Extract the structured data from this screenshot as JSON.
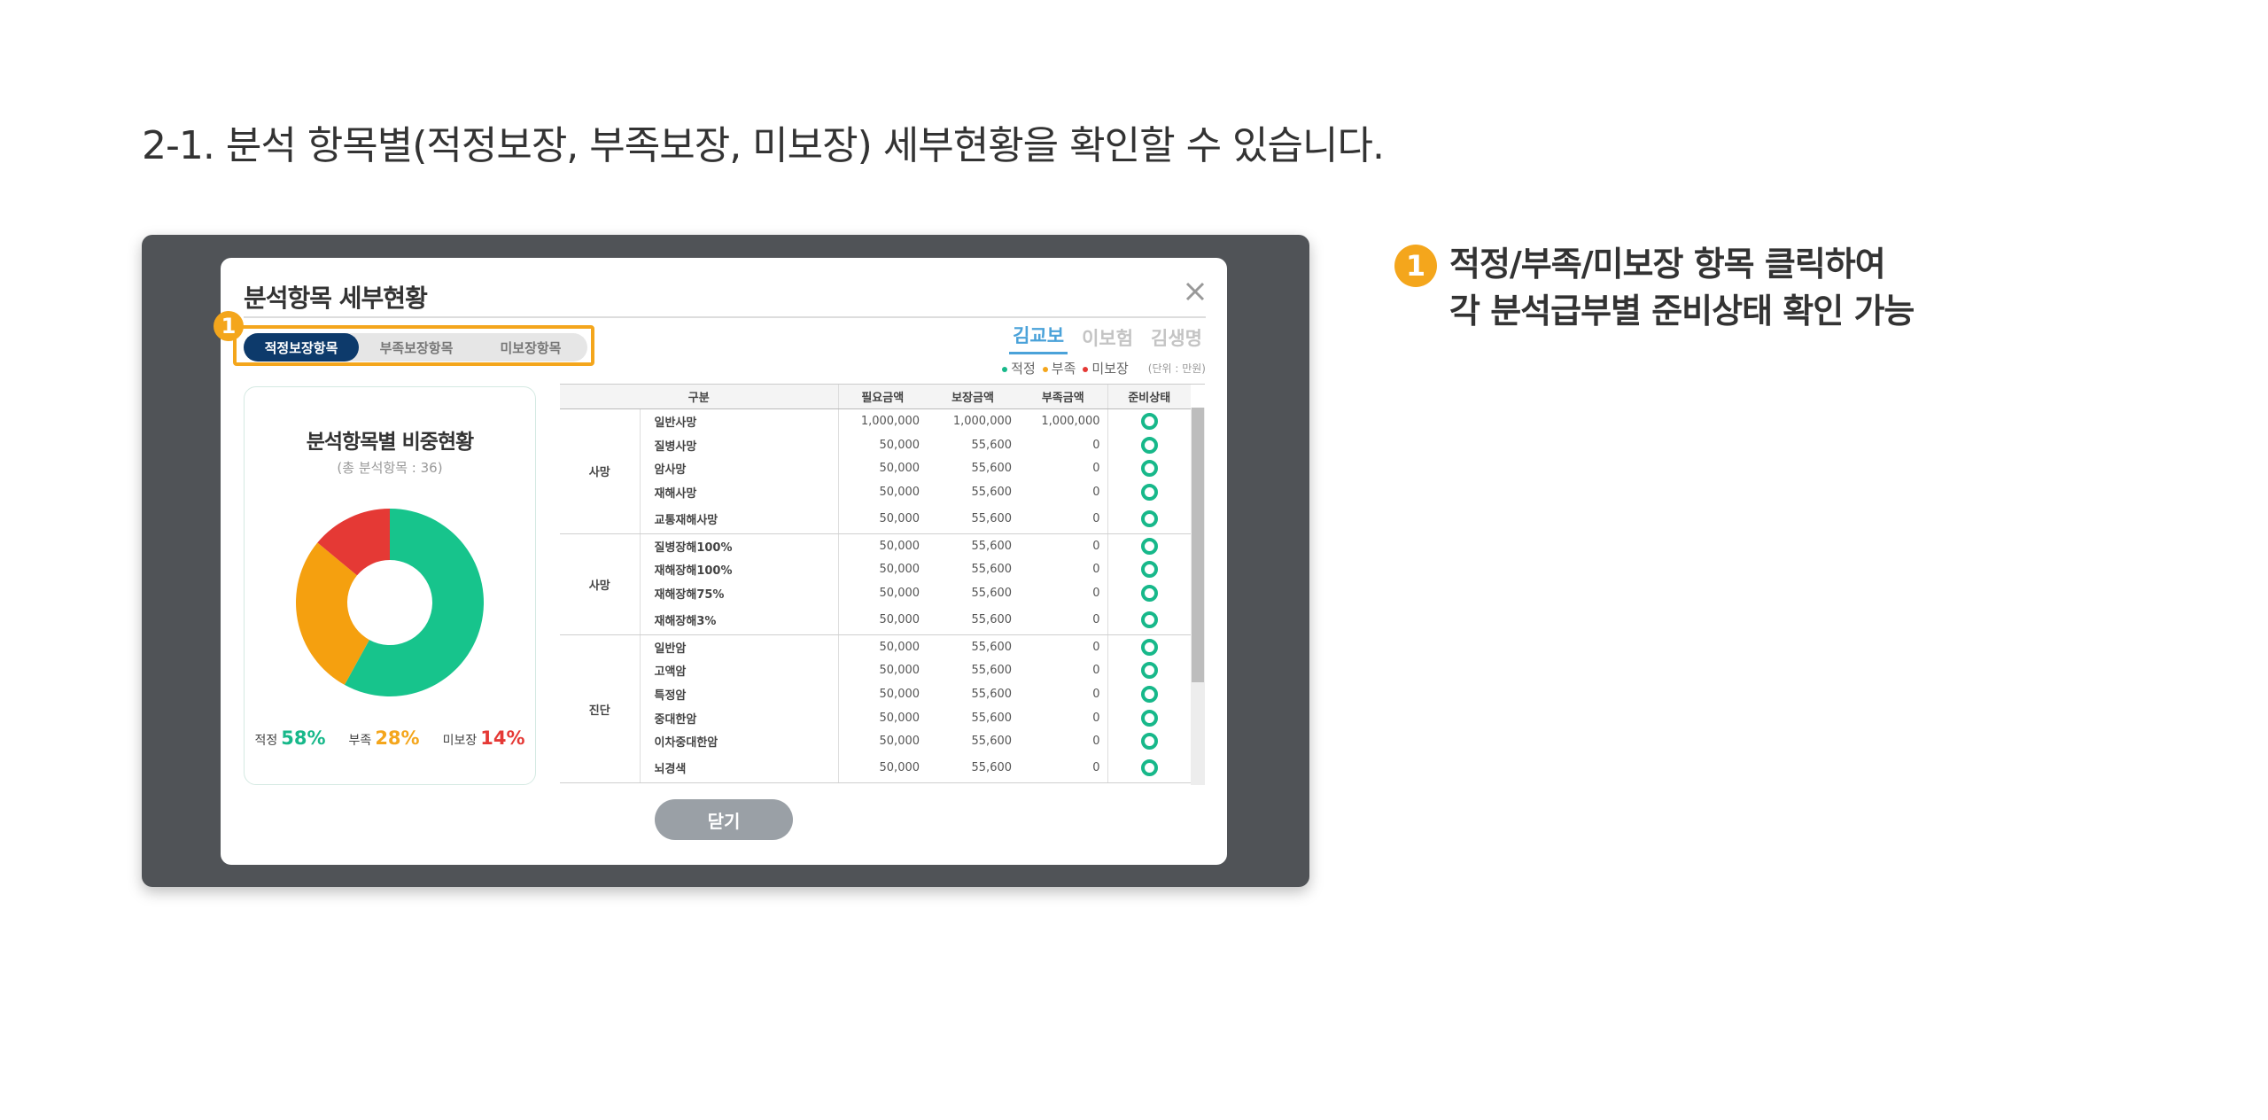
{
  "heading": "2-1. 분석 항목별(적정보장, 부족보장, 미보장) 세부현황을 확인할 수 있습니다.",
  "dialog": {
    "title": "분석항목 세부현황",
    "badge": "1",
    "tabs": [
      "적정보장항목",
      "부족보장항목",
      "미보장항목"
    ],
    "active_tab": 0,
    "persons": [
      "김교보",
      "이보험",
      "김생명"
    ],
    "active_person": 0,
    "legend": [
      {
        "label": "적정",
        "color": "#17b88a"
      },
      {
        "label": "부족",
        "color": "#f4a61c"
      },
      {
        "label": "미보장",
        "color": "#e53935"
      }
    ],
    "unit": "(단위 : 만원)",
    "card": {
      "title": "분석항목별 비중현황",
      "subtitle": "(총 분석항목 : 36)",
      "segments": [
        {
          "label": "적정",
          "value": 58,
          "display": "58%",
          "color": "#17c48c"
        },
        {
          "label": "부족",
          "value": 28,
          "display": "28%",
          "color": "#f5a00f"
        },
        {
          "label": "미보장",
          "value": 14,
          "display": "14%",
          "color": "#e53935"
        }
      ]
    },
    "table": {
      "headers": [
        "구분",
        "필요금액",
        "보장금액",
        "부족금액",
        "준비상태"
      ],
      "groups": [
        {
          "name": "사망",
          "rows": [
            {
              "item": "일반사망",
              "need": "1,000,000",
              "cover": "1,000,000",
              "short": "1,000,000"
            },
            {
              "item": "질병사망",
              "need": "50,000",
              "cover": "55,600",
              "short": "0"
            },
            {
              "item": "암사망",
              "need": "50,000",
              "cover": "55,600",
              "short": "0"
            },
            {
              "item": "재해사망",
              "need": "50,000",
              "cover": "55,600",
              "short": "0"
            },
            {
              "item": "교통재해사망",
              "need": "50,000",
              "cover": "55,600",
              "short": "0"
            }
          ]
        },
        {
          "name": "사망",
          "rows": [
            {
              "item": "질병장해100%",
              "need": "50,000",
              "cover": "55,600",
              "short": "0"
            },
            {
              "item": "재해장해100%",
              "need": "50,000",
              "cover": "55,600",
              "short": "0"
            },
            {
              "item": "재해장해75%",
              "need": "50,000",
              "cover": "55,600",
              "short": "0"
            },
            {
              "item": "재해장해3%",
              "need": "50,000",
              "cover": "55,600",
              "short": "0"
            }
          ]
        },
        {
          "name": "진단",
          "rows": [
            {
              "item": "일반암",
              "need": "50,000",
              "cover": "55,600",
              "short": "0"
            },
            {
              "item": "고액암",
              "need": "50,000",
              "cover": "55,600",
              "short": "0"
            },
            {
              "item": "특정암",
              "need": "50,000",
              "cover": "55,600",
              "short": "0"
            },
            {
              "item": "중대한암",
              "need": "50,000",
              "cover": "55,600",
              "short": "0"
            },
            {
              "item": "이차중대한암",
              "need": "50,000",
              "cover": "55,600",
              "short": "0"
            },
            {
              "item": "뇌경색",
              "need": "50,000",
              "cover": "55,600",
              "short": "0"
            }
          ]
        }
      ]
    },
    "close_label": "닫기"
  },
  "callout": {
    "badge": "1",
    "line1": "적정/부족/미보장 항목 클릭하여",
    "line2": "각 분석급부별 준비상태 확인 가능"
  }
}
